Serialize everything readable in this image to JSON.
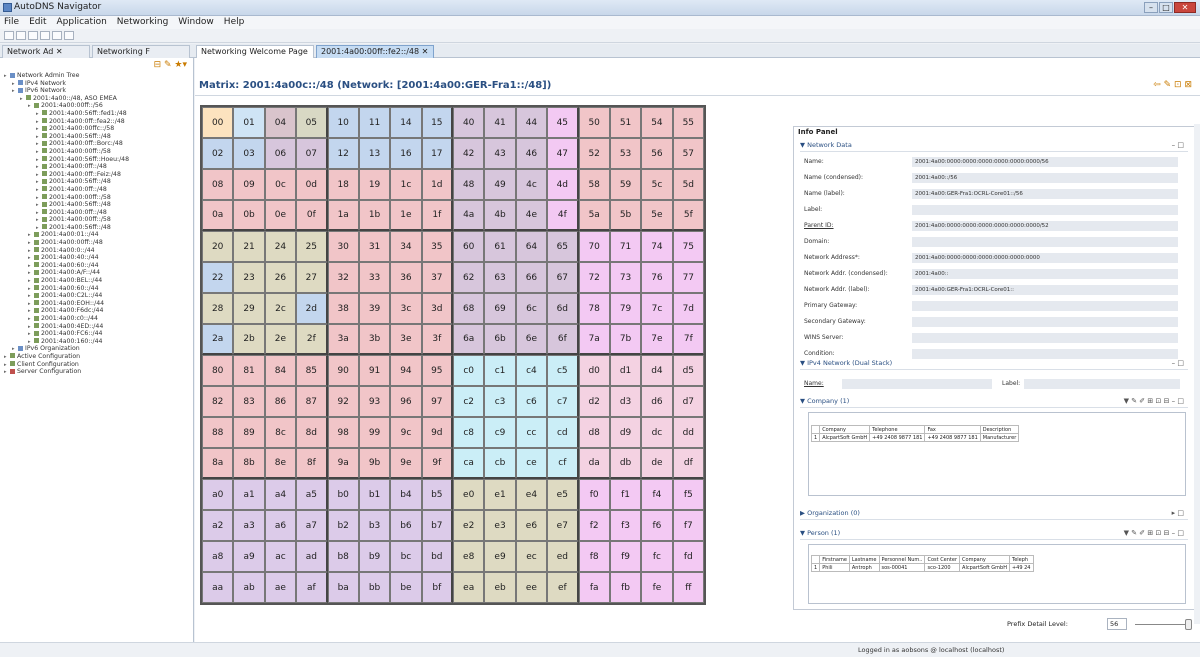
{
  "window": {
    "title": "AutoDNS Navigator",
    "controls": [
      "–",
      "□",
      "✕"
    ]
  },
  "menu": [
    "File",
    "Edit",
    "Application",
    "Networking",
    "Window",
    "Help"
  ],
  "toolbar_icons": [
    "new-icon",
    "save-icon",
    "print-icon",
    "back-icon",
    "forward-icon",
    "edit-icon"
  ],
  "tabs": {
    "left": [
      "Network Ad",
      "Networking F"
    ],
    "main": [
      "Networking Welcome Page",
      "2001:4a00:00ff::fe2::/48"
    ]
  },
  "tree": [
    {
      "d": 0,
      "t": "Network Admin Tree",
      "i": "b"
    },
    {
      "d": 1,
      "t": "IPv4 Network",
      "i": "b"
    },
    {
      "d": 1,
      "t": "IPv6 Network",
      "i": "b"
    },
    {
      "d": 2,
      "t": "2001:4a00::/48, ASO EMEA",
      "i": "g"
    },
    {
      "d": 3,
      "t": "2001:4a00:00ff::/56",
      "i": "g"
    },
    {
      "d": 4,
      "t": "2001:4a00:56ff::fed1:/48",
      "i": "g"
    },
    {
      "d": 4,
      "t": "2001:4a00:0ff::fea2::/48",
      "i": "g"
    },
    {
      "d": 4,
      "t": "2001:4a00:00ffc::/58",
      "i": "g"
    },
    {
      "d": 4,
      "t": "2001:4a00:56ff::/48",
      "i": "g"
    },
    {
      "d": 4,
      "t": "2001:4a00:0ff::Borc:/48",
      "i": "g"
    },
    {
      "d": 4,
      "t": "2001:4a00:00ff::/58",
      "i": "g"
    },
    {
      "d": 4,
      "t": "2001:4a00:56ff::Hoeu:/48",
      "i": "g"
    },
    {
      "d": 4,
      "t": "2001:4a00:0ff::/48",
      "i": "g"
    },
    {
      "d": 4,
      "t": "2001:4a00:0ff::Feiz:/48",
      "i": "g"
    },
    {
      "d": 4,
      "t": "2001:4a00:56ff::/48",
      "i": "g"
    },
    {
      "d": 4,
      "t": "2001:4a00:0ff::/48",
      "i": "g"
    },
    {
      "d": 4,
      "t": "2001:4a00:00ff::/58",
      "i": "g"
    },
    {
      "d": 4,
      "t": "2001:4a00:56ff::/48",
      "i": "g"
    },
    {
      "d": 4,
      "t": "2001:4a00:0ff::/48",
      "i": "g"
    },
    {
      "d": 4,
      "t": "2001:4a00:00ff::/58",
      "i": "g"
    },
    {
      "d": 4,
      "t": "2001:4a00:56ff::/48",
      "i": "g"
    },
    {
      "d": 3,
      "t": "2001:4a00:01::/44",
      "i": "g"
    },
    {
      "d": 3,
      "t": "2001:4a00:00ff::/48",
      "i": "g"
    },
    {
      "d": 3,
      "t": "2001:4a00:0::/44",
      "i": "g"
    },
    {
      "d": 3,
      "t": "2001:4a00:40::/44",
      "i": "g"
    },
    {
      "d": 3,
      "t": "2001:4a00:60::/44",
      "i": "g"
    },
    {
      "d": 3,
      "t": "2001:4a00:A/F::/44",
      "i": "g"
    },
    {
      "d": 3,
      "t": "2001:4a00:BEL::/44",
      "i": "g"
    },
    {
      "d": 3,
      "t": "2001:4a00:60::/44",
      "i": "g"
    },
    {
      "d": 3,
      "t": "2001:4a00:C2L::/44",
      "i": "g"
    },
    {
      "d": 3,
      "t": "2001:4a00:EOH::/44",
      "i": "g"
    },
    {
      "d": 3,
      "t": "2001:4a00:F6dc:/44",
      "i": "g"
    },
    {
      "d": 3,
      "t": "2001:4a00:c0::/44",
      "i": "g"
    },
    {
      "d": 3,
      "t": "2001:4a00:4ED::/44",
      "i": "g"
    },
    {
      "d": 3,
      "t": "2001:4a00:FC6::/44",
      "i": "g"
    },
    {
      "d": 3,
      "t": "2001:4a00:160::/44",
      "i": "g"
    },
    {
      "d": 1,
      "t": "IPv6 Organization",
      "i": "b"
    },
    {
      "d": 0,
      "t": "Active Configuration",
      "i": "g"
    },
    {
      "d": 0,
      "t": "Client Configuration",
      "i": "g"
    },
    {
      "d": 0,
      "t": "Server Configuration",
      "i": "r"
    }
  ],
  "matrix": {
    "title": "Matrix: 2001:4a00c::/48 (Network: [2001:4a00:GER-Fra1::/48])",
    "colors": {
      "c00": "#fce3bf",
      "c01": "#cfe4f5",
      "c04": "#d9c4cc",
      "c05": "#d8d8c4",
      "c10": "#c8d8ec",
      "c11": "#c8d8ec",
      "c40": "#d2c2d8",
      "c45": "#e6c8ea",
      "c50": "#f7c8c6",
      "c55": "#f7c8c6",
      "c02": "#b9c7e3",
      "c06": "#d8c6d2",
      "blue": "#c3d6ee",
      "pink": "#f1c5c8",
      "purple": "#d7c6dc",
      "mauve": "#f3c9f3",
      "khaki": "#dedac2",
      "cyan": "#cbeef7",
      "rose": "#f4d2e2",
      "lav": "#dccbe9"
    },
    "rows": [
      [
        "00",
        "01",
        "04",
        "05",
        "10",
        "11",
        "14",
        "15",
        "40",
        "41",
        "44",
        "45",
        "50",
        "51",
        "54",
        "55"
      ],
      [
        "02",
        "03",
        "06",
        "07",
        "12",
        "13",
        "16",
        "17",
        "42",
        "43",
        "46",
        "47",
        "52",
        "53",
        "56",
        "57"
      ],
      [
        "08",
        "09",
        "0c",
        "0d",
        "18",
        "19",
        "1c",
        "1d",
        "48",
        "49",
        "4c",
        "4d",
        "58",
        "59",
        "5c",
        "5d"
      ],
      [
        "0a",
        "0b",
        "0e",
        "0f",
        "1a",
        "1b",
        "1e",
        "1f",
        "4a",
        "4b",
        "4e",
        "4f",
        "5a",
        "5b",
        "5e",
        "5f"
      ],
      [
        "20",
        "21",
        "24",
        "25",
        "30",
        "31",
        "34",
        "35",
        "60",
        "61",
        "64",
        "65",
        "70",
        "71",
        "74",
        "75"
      ],
      [
        "22",
        "23",
        "26",
        "27",
        "32",
        "33",
        "36",
        "37",
        "62",
        "63",
        "66",
        "67",
        "72",
        "73",
        "76",
        "77"
      ],
      [
        "28",
        "29",
        "2c",
        "2d",
        "38",
        "39",
        "3c",
        "3d",
        "68",
        "69",
        "6c",
        "6d",
        "78",
        "79",
        "7c",
        "7d"
      ],
      [
        "2a",
        "2b",
        "2e",
        "2f",
        "3a",
        "3b",
        "3e",
        "3f",
        "6a",
        "6b",
        "6e",
        "6f",
        "7a",
        "7b",
        "7e",
        "7f"
      ],
      [
        "80",
        "81",
        "84",
        "85",
        "90",
        "91",
        "94",
        "95",
        "c0",
        "c1",
        "c4",
        "c5",
        "d0",
        "d1",
        "d4",
        "d5"
      ],
      [
        "82",
        "83",
        "86",
        "87",
        "92",
        "93",
        "96",
        "97",
        "c2",
        "c3",
        "c6",
        "c7",
        "d2",
        "d3",
        "d6",
        "d7"
      ],
      [
        "88",
        "89",
        "8c",
        "8d",
        "98",
        "99",
        "9c",
        "9d",
        "c8",
        "c9",
        "cc",
        "cd",
        "d8",
        "d9",
        "dc",
        "dd"
      ],
      [
        "8a",
        "8b",
        "8e",
        "8f",
        "9a",
        "9b",
        "9e",
        "9f",
        "ca",
        "cb",
        "ce",
        "cf",
        "da",
        "db",
        "de",
        "df"
      ],
      [
        "a0",
        "a1",
        "a4",
        "a5",
        "b0",
        "b1",
        "b4",
        "b5",
        "e0",
        "e1",
        "e4",
        "e5",
        "f0",
        "f1",
        "f4",
        "f5"
      ],
      [
        "a2",
        "a3",
        "a6",
        "a7",
        "b2",
        "b3",
        "b6",
        "b7",
        "e2",
        "e3",
        "e6",
        "e7",
        "f2",
        "f3",
        "f6",
        "f7"
      ],
      [
        "a8",
        "a9",
        "ac",
        "ad",
        "b8",
        "b9",
        "bc",
        "bd",
        "e8",
        "e9",
        "ec",
        "ed",
        "f8",
        "f9",
        "fc",
        "fd"
      ],
      [
        "aa",
        "ab",
        "ae",
        "af",
        "ba",
        "bb",
        "be",
        "bf",
        "ea",
        "eb",
        "ee",
        "ef",
        "fa",
        "fb",
        "fe",
        "ff"
      ]
    ]
  },
  "info_panel": {
    "title": "Info Panel",
    "network_data": {
      "section": "Network Data",
      "fields": [
        {
          "label": "Name:",
          "value": "2001:4a00:0000:0000:0000:0000:0000:0000/56"
        },
        {
          "label": "Name (condensed):",
          "value": "2001:4a00::/56"
        },
        {
          "label": "Name (label):",
          "value": "2001:4a00:GER-Fra1:OCRL-Core01::/56"
        },
        {
          "label": "Label:",
          "value": ""
        },
        {
          "label": "Parent ID:",
          "value": "2001:4a00:0000:0000:0000:0000:0000:0000/52",
          "link": true
        },
        {
          "label": "Domain:",
          "value": ""
        },
        {
          "label": "Network Address*:",
          "value": "2001:4a00:0000:0000:0000:0000:0000:0000"
        },
        {
          "label": "Network Addr. (condensed):",
          "value": "2001:4a00::"
        },
        {
          "label": "Network Addr. (label):",
          "value": "2001:4a00:GER-Fra1:OCRL-Core01::"
        },
        {
          "label": "Primary Gateway:",
          "value": ""
        },
        {
          "label": "Secondary Gateway:",
          "value": ""
        },
        {
          "label": "WINS Server:",
          "value": ""
        },
        {
          "label": "Condition:",
          "value": ""
        }
      ]
    },
    "ipv4_network": {
      "section": "IPv4 Network (Dual Stack)",
      "name_label": "Name:",
      "label_label": "Label:"
    },
    "company": {
      "section": "Company (1)",
      "headers": [
        "Company",
        "Telephone",
        "Fax",
        "Description"
      ],
      "rows": [
        [
          "1",
          "AlcpartSoft GmbH",
          "+49 2408 9877 181",
          "+49 2408 9877 181",
          "Manufacturer"
        ]
      ]
    },
    "organization": {
      "section": "Organization (0)"
    },
    "person": {
      "section": "Person (1)",
      "headers": [
        "Firstname",
        "Lastname",
        "Personnel Num..",
        "Cost Center",
        "Company",
        "Teleph"
      ],
      "rows": [
        [
          "1",
          "Phili",
          "Antroph",
          "sos-00041",
          "sco-1200",
          "AlcpartSoft GmbH",
          "+49 24"
        ]
      ]
    },
    "section_icons": "▼ ✎ ✐ ⊞ ⊡ ⊟ – □"
  },
  "prefix_detail": {
    "label": "Prefix Detail Level:",
    "value": "56"
  },
  "status": {
    "text": "Logged in as aobsons @ localhost (localhost)"
  }
}
